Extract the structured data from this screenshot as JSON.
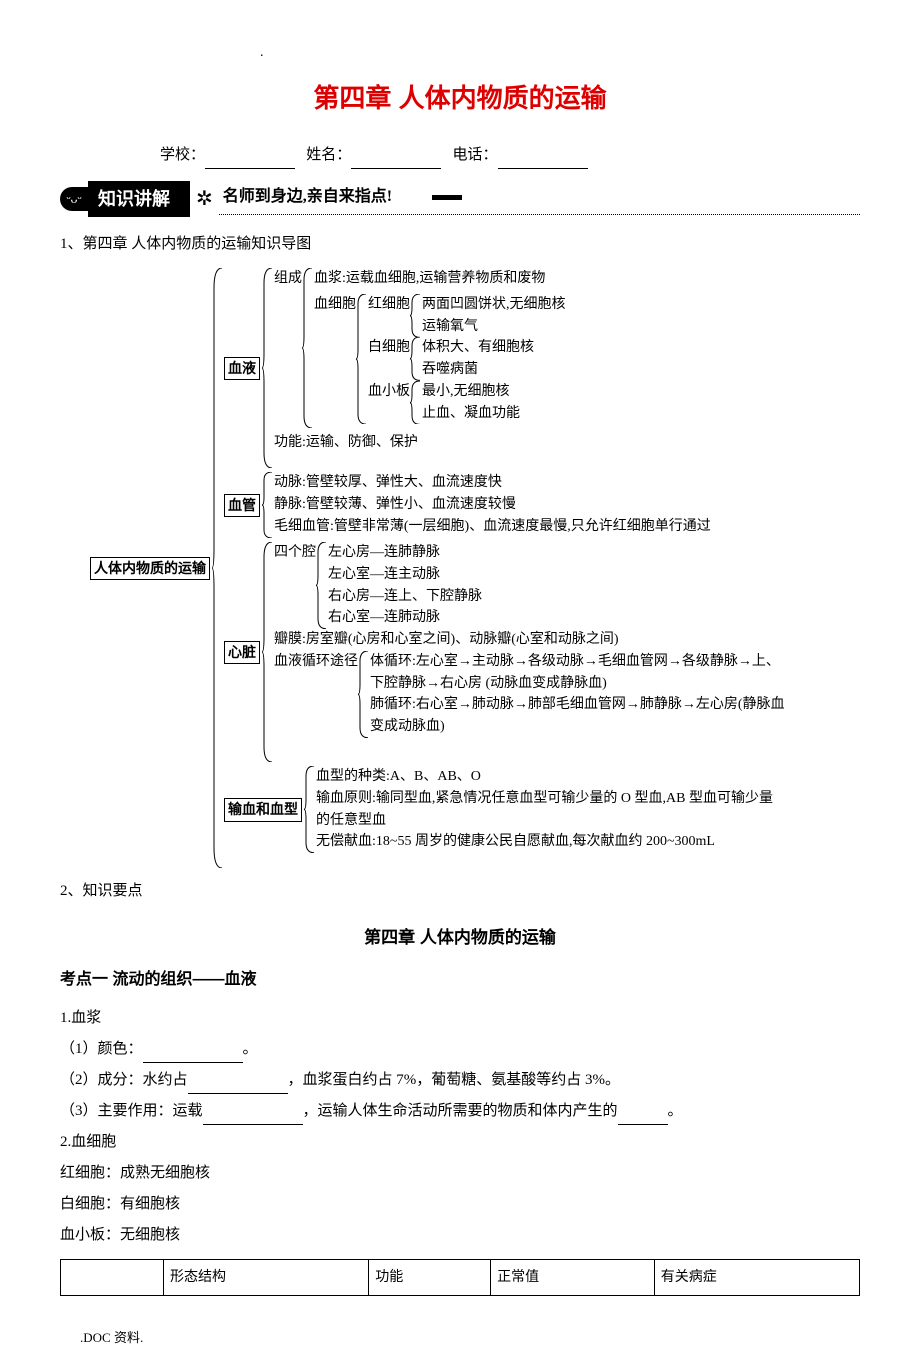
{
  "dot": ".",
  "title": "第四章    人体内物质的运输",
  "info": {
    "school_label": "学校：",
    "name_label": "姓名：",
    "phone_label": "电话："
  },
  "banner": {
    "smile": "ᵕᴗᵕ",
    "main": "知识讲解",
    "flower": "✲",
    "sub": "名师到身边,亲自来指点!"
  },
  "sections": {
    "s1": "1、第四章    人体内物质的运输知识导图",
    "s2": "2、知识要点"
  },
  "chart_data": {
    "type": "tree",
    "root": "人体内物质的运输",
    "branches": {
      "blood_box": "血液",
      "blood_plasma": "血浆:运载血细胞,运输营养物质和废物",
      "blood_comp": "组成",
      "blood_cells_lbl": "血细胞",
      "rbc": "红细胞",
      "rbc_1": "两面凹圆饼状,无细胞核",
      "rbc_2": "运输氧气",
      "wbc": "白细胞",
      "wbc_1": "体积大、有细胞核",
      "wbc_2": "吞噬病菌",
      "plt": "血小板",
      "plt_1": "最小,无细胞核",
      "plt_2": "止血、凝血功能",
      "blood_fn": "功能:运输、防御、保护",
      "vessel_box": "血管",
      "artery": "动脉:管壁较厚、弹性大、血流速度快",
      "vein": "静脉:管壁较薄、弹性小、血流速度较慢",
      "capillary": "毛细血管:管壁非常薄(一层细胞)、血流速度最慢,只允许红细胞单行通过",
      "heart_box": "心脏",
      "chambers_lbl": "四个腔",
      "c1": "左心房—连肺静脉",
      "c2": "左心室—连主动脉",
      "c3": "右心房—连上、下腔静脉",
      "c4": "右心室—连肺动脉",
      "valve": "瓣膜:房室瓣(心房和心室之间)、动脉瓣(心室和动脉之间)",
      "circ_lbl": "血液循环途径",
      "systemic": "体循环:左心室→主动脉→各级动脉→毛细血管网→各级静脉→上、下腔静脉→右心房 (动脉血变成静脉血)",
      "pulmonary": "肺循环:右心室→肺动脉→肺部毛细血管网→肺静脉→左心房(静脉血变成动脉血)",
      "transf_box": "输血和血型",
      "bt_types": "血型的种类:A、B、AB、O",
      "bt_rule": "输血原则:输同型血,紧急情况任意血型可输少量的 O 型血,AB 型血可输少量的任意型血",
      "bt_donate": "无偿献血:18~55 周岁的健康公民自愿献血,每次献血约 200~300mL"
    }
  },
  "subtitle": "第四章    人体内物质的运输",
  "point1": {
    "title": "考点一    流动的组织——血液",
    "p1": "1.血浆",
    "p1_1a": "（1）颜色：",
    "p1_1b": "。",
    "p1_2a": "（2）成分：水约占",
    "p1_2b": "，血浆蛋白约占 7%，葡萄糖、氨基酸等约占 3%。",
    "p1_3a": "（3）主要作用：运载",
    "p1_3b": "，运输人体生命活动所需要的物质和体内产生的",
    "p1_3c": "。",
    "p2": "2.血细胞",
    "p2_1": "红细胞：成熟无细胞核",
    "p2_2": "白细胞：有细胞核",
    "p2_3": "血小板：无细胞核"
  },
  "table": {
    "h1": "",
    "h2": "形态结构",
    "h3": "功能",
    "h4": "正常值",
    "h5": "有关病症"
  },
  "footer": ".DOC 资料."
}
